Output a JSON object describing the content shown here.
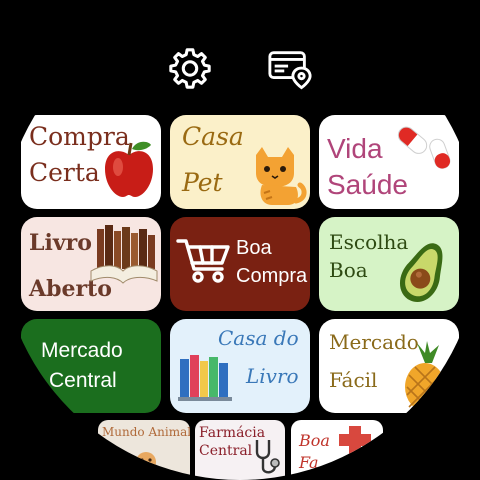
{
  "top_icons": [
    {
      "name": "gear-icon"
    },
    {
      "name": "card-location-icon"
    }
  ],
  "tiles": [
    {
      "line1": "Compra",
      "line2": "Certa",
      "icon": "apple-icon",
      "bg": "#ffffff",
      "color": "#7a2e1d"
    },
    {
      "line1": "Casa",
      "line2": "Pet",
      "icon": "cat-icon",
      "bg": "#fbf0c9",
      "color": "#9a6a12"
    },
    {
      "line1": "Vida",
      "line2": "Saúde",
      "icon": "pills-icon",
      "bg": "#ffffff",
      "color": "#b0457a"
    },
    {
      "line1": "Livro",
      "line2": "Aberto",
      "icon": "books-icon",
      "bg": "#f7e6e2",
      "color": "#6b3a2a"
    },
    {
      "line1": "Boa",
      "line2": "Compra",
      "icon": "cart-icon",
      "bg": "#7a2112",
      "color": "#ffffff"
    },
    {
      "line1": "Escolha",
      "line2": "Boa",
      "icon": "avocado-icon",
      "bg": "#d6f3c6",
      "color": "#2e4a12"
    },
    {
      "line1": "Mercado",
      "line2": "Central",
      "icon": "",
      "bg": "#1b6e1e",
      "color": "#ffffff"
    },
    {
      "line1": "Casa do",
      "line2": "Livro",
      "icon": "books-row-icon",
      "bg": "#e3f1fb",
      "color": "#3a78b8"
    },
    {
      "line1": "Mercado",
      "line2": "Fácil",
      "icon": "pineapple-icon",
      "bg": "#ffffff",
      "color": "#8a6a1a"
    }
  ],
  "bottom_tiles": [
    {
      "line1": "Mundo Animal",
      "line2": "",
      "icon": "pet-icon",
      "bg": "#ede6dc",
      "color": "#b06a3a"
    },
    {
      "line1": "Farmácia",
      "line2": "Central",
      "icon": "stethoscope-icon",
      "bg": "#f6f1f3",
      "color": "#8a1f2a"
    },
    {
      "line1": "Boa",
      "line2": "Fa",
      "icon": "cross-icon",
      "bg": "#ffffff",
      "color": "#c0342b"
    }
  ]
}
